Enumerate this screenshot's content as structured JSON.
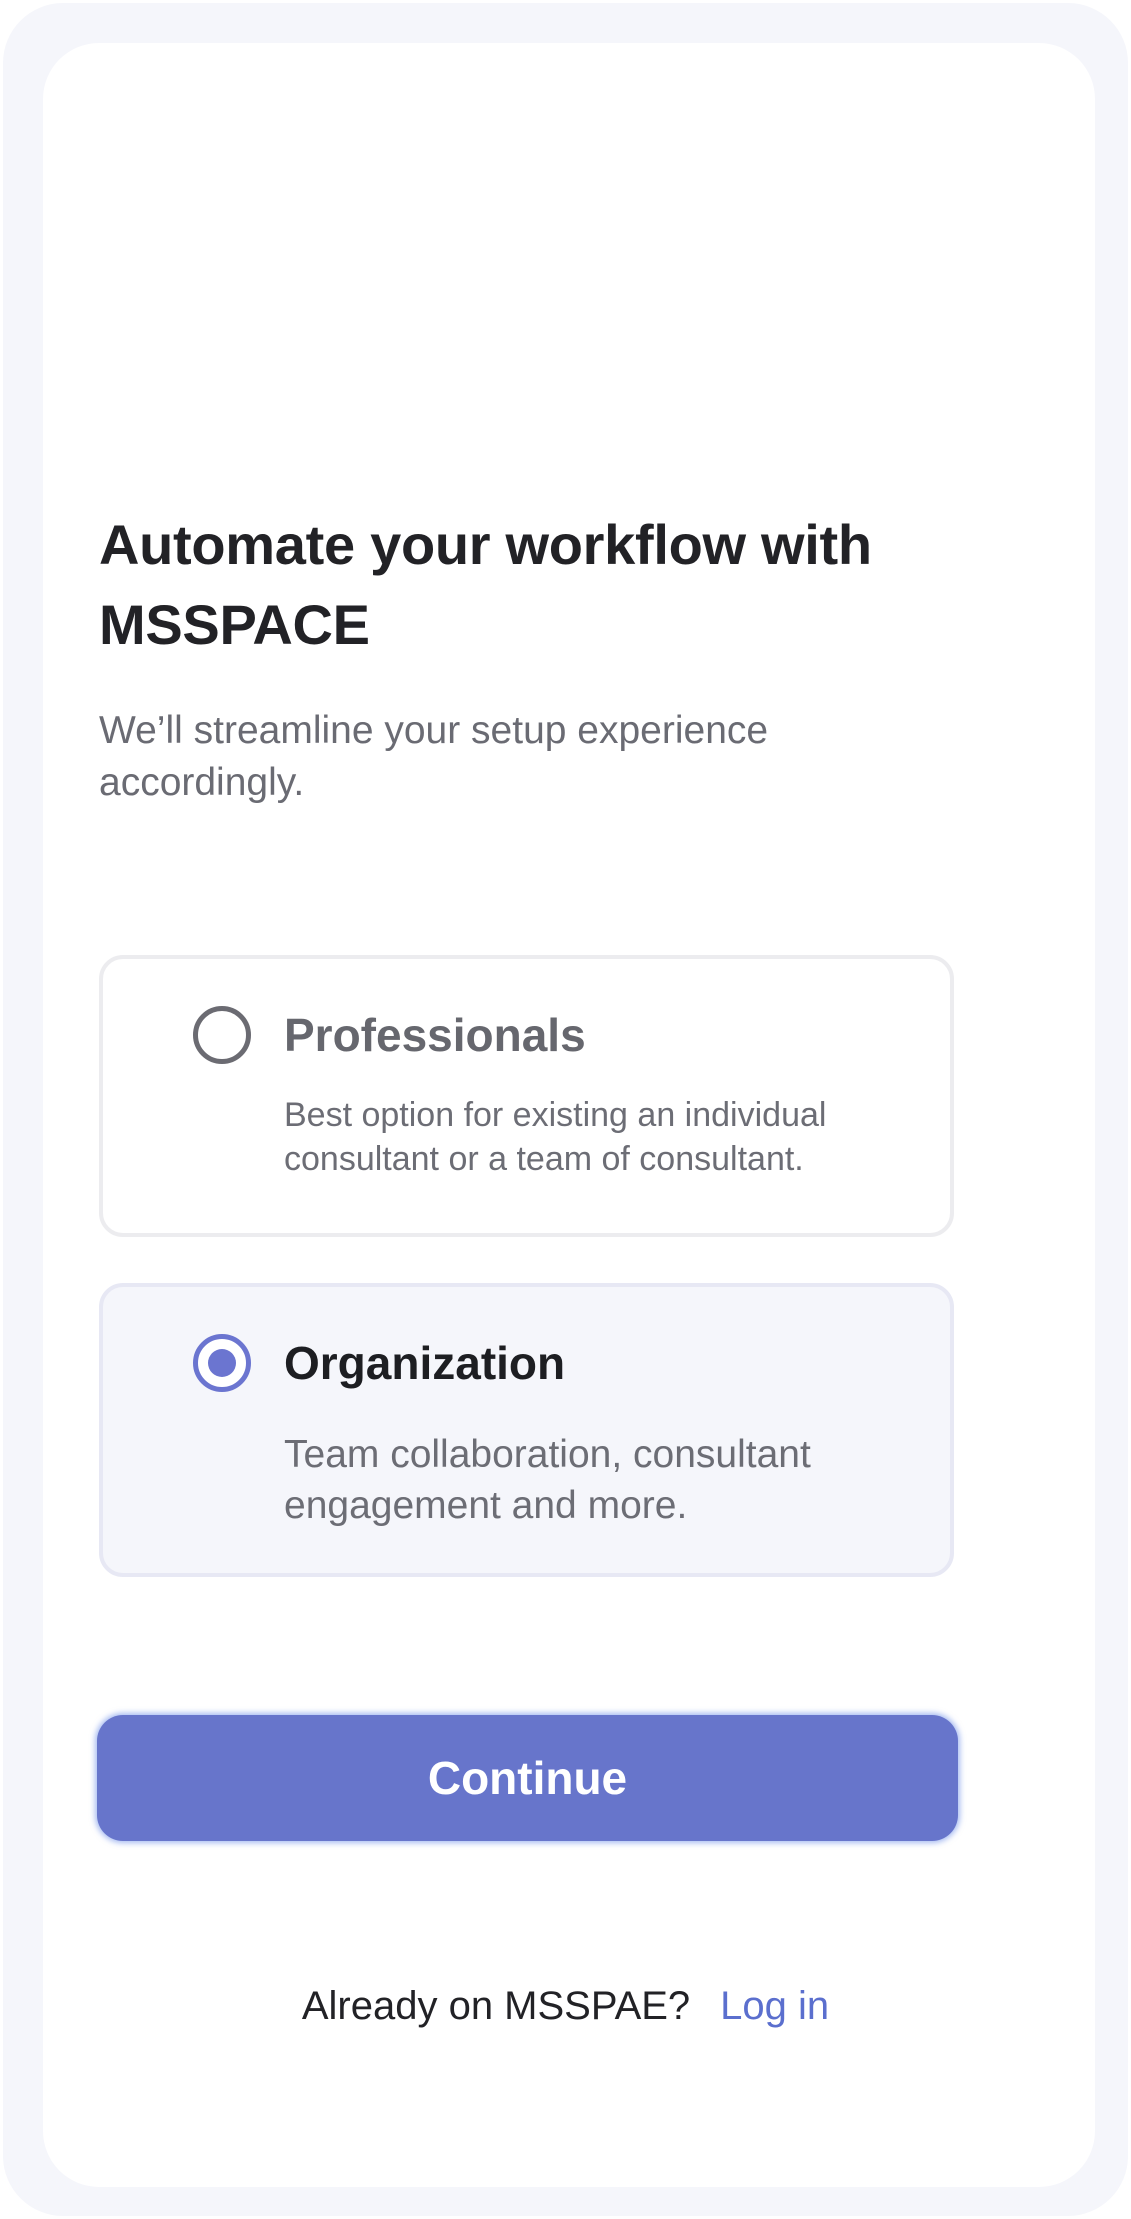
{
  "onboarding": {
    "headline": "Automate your workflow with MSSPACE",
    "subtitle": "We’ll streamline your setup experience accordingly."
  },
  "options": [
    {
      "title": "Professionals",
      "description": "Best option for existing an individual consultant or a team of consultant.",
      "selected": false
    },
    {
      "title": "Organization",
      "description": "Team collaboration, consultant engagement and more.",
      "selected": true
    }
  ],
  "actions": {
    "continue_label": "Continue"
  },
  "footer": {
    "login_prompt": "Already on MSSPAE?",
    "login_link": "Log in"
  },
  "colors": {
    "accent": "#6775cb",
    "link": "#5b6fce",
    "selected_card_bg": "#f5f6fb",
    "frame": "#f5f6fb"
  }
}
